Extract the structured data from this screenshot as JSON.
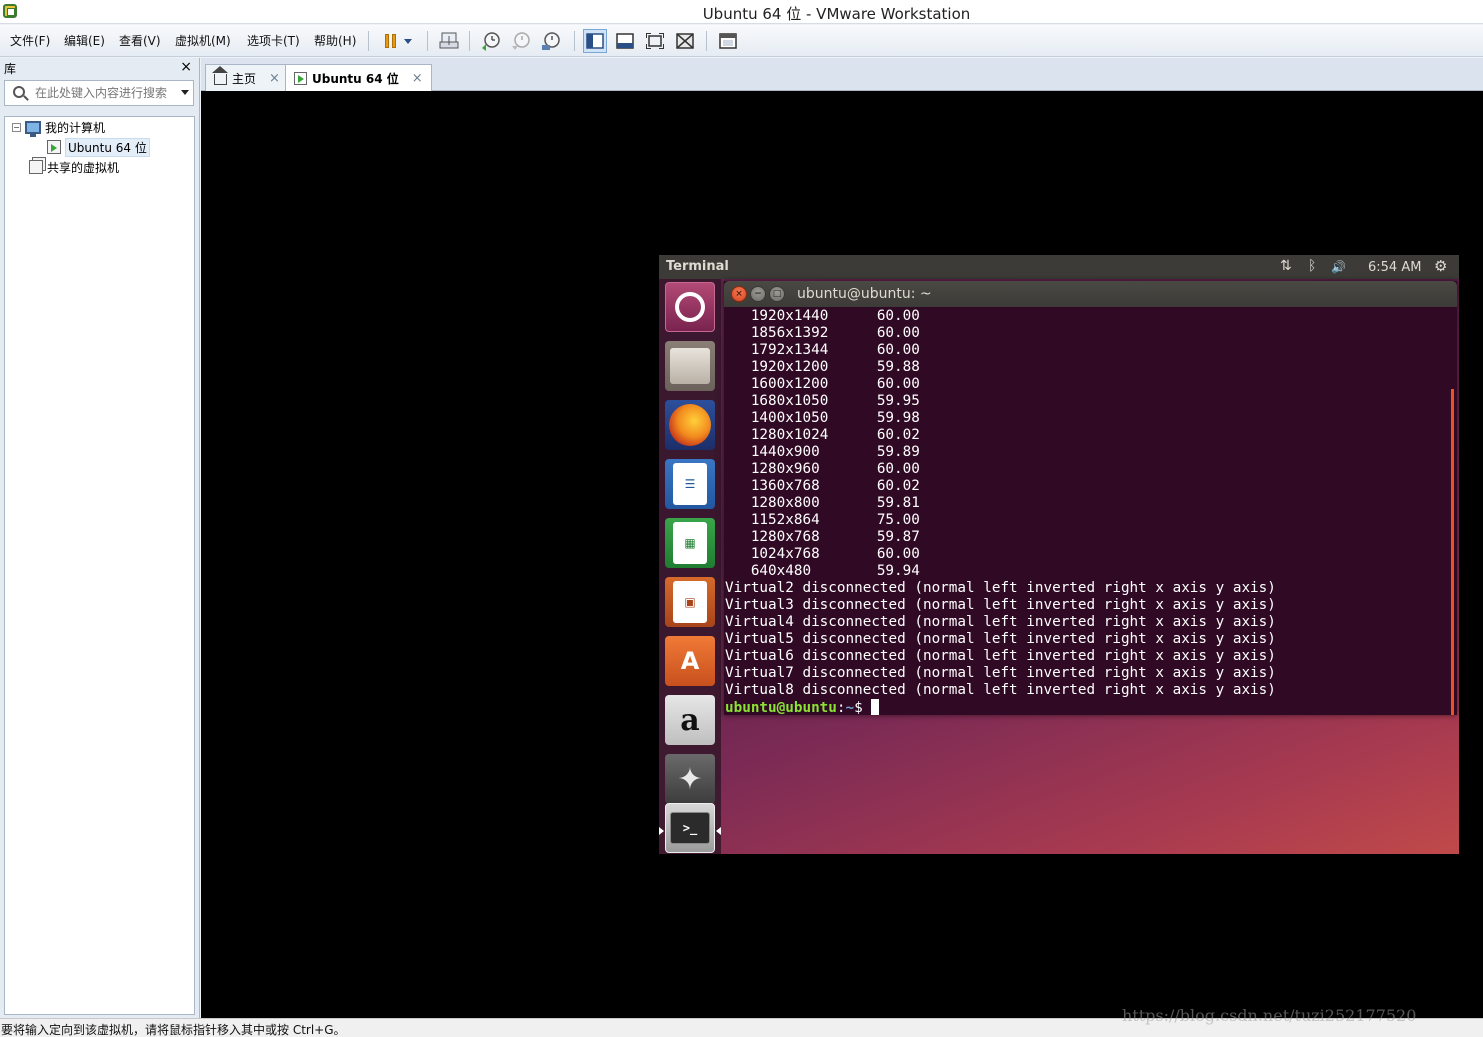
{
  "window": {
    "title": "Ubuntu 64 位 - VMware Workstation"
  },
  "menu": [
    {
      "label": "文件(F)"
    },
    {
      "label": "编辑(E)"
    },
    {
      "label": "查看(V)"
    },
    {
      "label": "虚拟机(M)"
    },
    {
      "label": "选项卡(T)"
    },
    {
      "label": "帮助(H)"
    }
  ],
  "toolbar": {
    "icons": [
      "pause-icon",
      "dropdown-arrow-icon",
      "send-keys-icon",
      "snapshot-take-icon",
      "snapshot-revert-icon",
      "snapshot-manager-icon",
      "library-view-icon",
      "thumbnail-bar-icon",
      "fullscreen-icon",
      "unity-icon",
      "console-view-icon"
    ]
  },
  "library": {
    "title": "库",
    "close": "×",
    "search_placeholder": "在此处键入内容进行搜索",
    "tree": [
      {
        "label": "我的计算机",
        "toggle": "−"
      },
      {
        "label": "Ubuntu 64 位"
      },
      {
        "label": "共享的虚拟机"
      }
    ]
  },
  "tabs": [
    {
      "label": "主页",
      "close": "×"
    },
    {
      "label": "Ubuntu 64 位",
      "close": "×"
    }
  ],
  "ubuntu": {
    "topbar_title": "Terminal",
    "clock": "6:54 AM",
    "indicators": {
      "network": "⇅",
      "bluetooth": "ᛒ",
      "volume": "🔊",
      "session": "⚙"
    },
    "launcher": [
      "dash",
      "files",
      "firefox",
      "writer",
      "calc",
      "impress",
      "software-center",
      "amazon",
      "system-settings",
      "terminal"
    ],
    "launcher_glyphs": {
      "writer": "☰",
      "calc": "▦",
      "impress": "▣",
      "software": "A",
      "amazon": "a",
      "settings": "✦",
      "terminal": ">_"
    }
  },
  "terminal": {
    "title": "ubuntu@ubuntu: ~",
    "modes": [
      {
        "res": "1920x1440",
        "rate": "60.00"
      },
      {
        "res": "1856x1392",
        "rate": "60.00"
      },
      {
        "res": "1792x1344",
        "rate": "60.00"
      },
      {
        "res": "1920x1200",
        "rate": "59.88"
      },
      {
        "res": "1600x1200",
        "rate": "60.00"
      },
      {
        "res": "1680x1050",
        "rate": "59.95"
      },
      {
        "res": "1400x1050",
        "rate": "59.98"
      },
      {
        "res": "1280x1024",
        "rate": "60.02"
      },
      {
        "res": "1440x900",
        "rate": "59.89"
      },
      {
        "res": "1280x960",
        "rate": "60.00"
      },
      {
        "res": "1360x768",
        "rate": "60.02"
      },
      {
        "res": "1280x800",
        "rate": "59.81"
      },
      {
        "res": "1152x864",
        "rate": "75.00"
      },
      {
        "res": "1280x768",
        "rate": "59.87"
      },
      {
        "res": "1024x768",
        "rate": "60.00"
      },
      {
        "res": "640x480",
        "rate": "59.94"
      }
    ],
    "outputs": [
      "Virtual2 disconnected (normal left inverted right x axis y axis)",
      "Virtual3 disconnected (normal left inverted right x axis y axis)",
      "Virtual4 disconnected (normal left inverted right x axis y axis)",
      "Virtual5 disconnected (normal left inverted right x axis y axis)",
      "Virtual6 disconnected (normal left inverted right x axis y axis)",
      "Virtual7 disconnected (normal left inverted right x axis y axis)",
      "Virtual8 disconnected (normal left inverted right x axis y axis)"
    ],
    "prompt_user": "ubuntu@ubuntu",
    "prompt_sep": ":",
    "prompt_path": "~",
    "prompt_symbol": "$ "
  },
  "statusbar": {
    "text": "要将输入定向到该虚拟机，请将鼠标指针移入其中或按 Ctrl+G。"
  },
  "watermark": "https://blog.csdn.net/tuzi252177520",
  "colors": {
    "terminal_bg": "#300a24",
    "prompt_user": "#8ae234",
    "prompt_path": "#729fcf",
    "ubuntu_orange": "#e95420"
  }
}
